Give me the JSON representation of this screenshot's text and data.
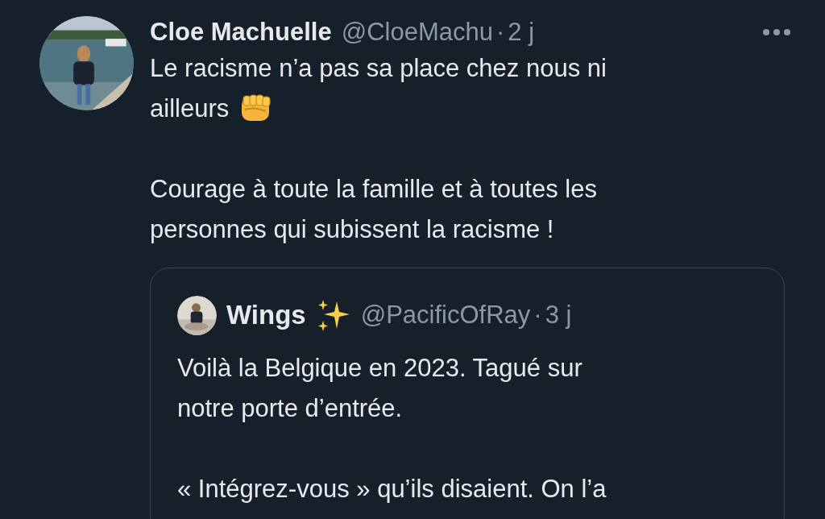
{
  "tweet": {
    "name": "Cloe Machuelle",
    "handle": "@CloeMachu",
    "separator": "·",
    "time": "2 j",
    "paragraphs": [
      {
        "lines": [
          "Le racisme n’a pas sa place chez nous ni",
          "ailleurs"
        ],
        "emoji": {
          "kind": "fist"
        }
      },
      {
        "lines": [
          "Courage à toute la famille et à toutes les",
          "personnes qui subissent la racisme !"
        ]
      }
    ],
    "quote": {
      "name": "Wings",
      "name_emoji": {
        "kind": "sparkles"
      },
      "handle": "@PacificOfRay",
      "separator": "·",
      "time": "3 j",
      "paragraphs": [
        {
          "lines": [
            "Voilà la Belgique en 2023. Tagué sur",
            "notre porte d’entrée."
          ]
        },
        {
          "lines": [
            "« Intégrez-vous » qu’ils disaient. On l’a"
          ]
        }
      ]
    }
  }
}
